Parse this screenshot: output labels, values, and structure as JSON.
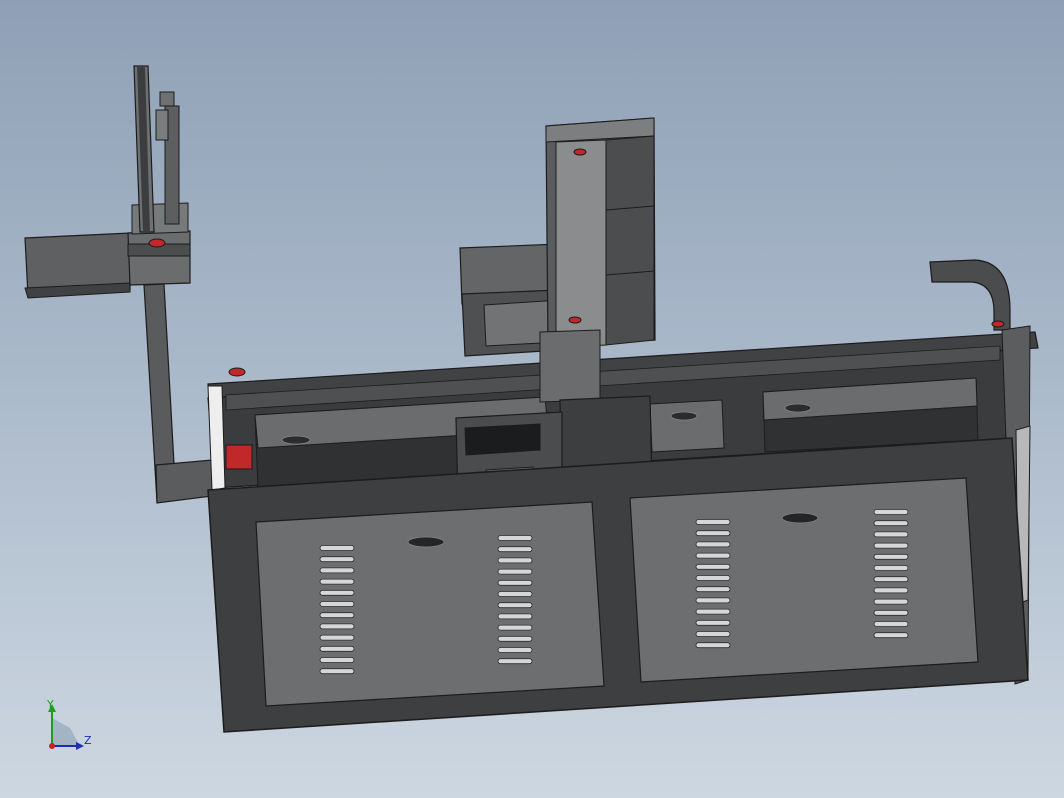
{
  "viewport": {
    "background_top": "#8fa0b6",
    "background_bottom": "#cdd7e1"
  },
  "colors": {
    "frame_dark": "#3d3f41",
    "panel_grey": "#6c6e6f",
    "part_grey": "#5b5d5f",
    "accent_red": "#c0282a",
    "edge_black": "#1c1c1c"
  },
  "triad": {
    "y_label": "Y",
    "z_label": "Z",
    "y_color": "#1aa01a",
    "z_color": "#1b2fb0",
    "x_color": "#cc2020"
  }
}
